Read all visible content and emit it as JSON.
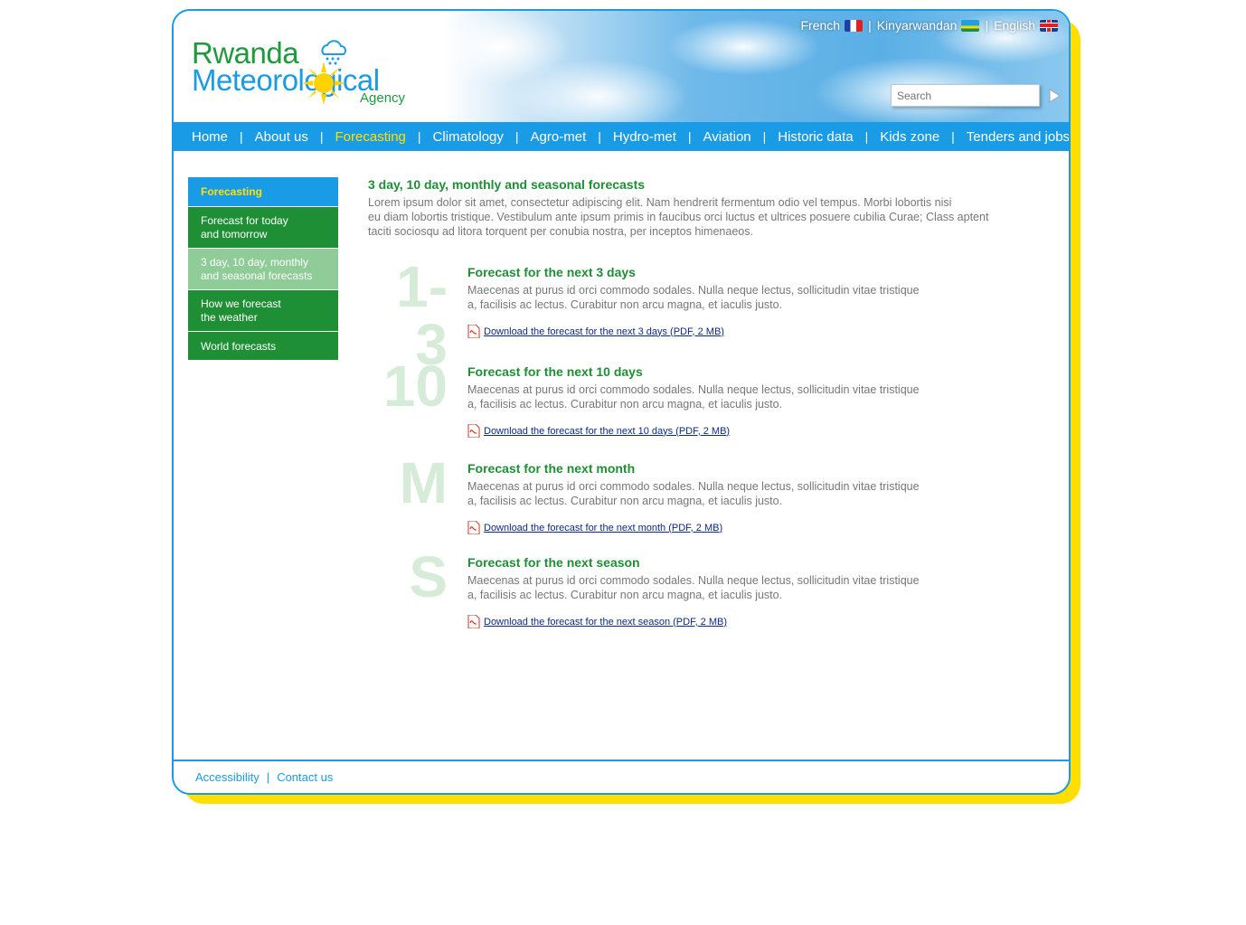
{
  "site": {
    "logo": {
      "line1": "Rwanda",
      "line2": "Meteorological",
      "line3": "Agency"
    }
  },
  "languages": [
    {
      "label": "French",
      "flag": "flag-france-icon"
    },
    {
      "label": "Kinyarwandan",
      "flag": "flag-rwanda-icon"
    },
    {
      "label": "English",
      "flag": "flag-uk-icon"
    }
  ],
  "search": {
    "placeholder": "Search"
  },
  "nav": [
    {
      "label": "Home"
    },
    {
      "label": "About us"
    },
    {
      "label": "Forecasting",
      "active": true
    },
    {
      "label": "Climatology"
    },
    {
      "label": "Agro-met"
    },
    {
      "label": "Hydro-met"
    },
    {
      "label": "Aviation"
    },
    {
      "label": "Historic data"
    },
    {
      "label": "Kids zone"
    },
    {
      "label": "Tenders and jobs"
    }
  ],
  "sidebar": {
    "heading": "Forecasting",
    "items": [
      {
        "line1": "Forecast for today",
        "line2": "and tomorrow"
      },
      {
        "line1": "3 day, 10 day, monthly",
        "line2": "and seasonal forecasts",
        "selected": true
      },
      {
        "line1": "How we forecast",
        "line2": "the weather"
      },
      {
        "line1": "World forecasts",
        "line2": ""
      }
    ]
  },
  "main": {
    "title": "3 day, 10 day, monthly and seasonal forecasts",
    "intro_lines": [
      "Lorem ipsum dolor sit amet, consectetur adipiscing elit. Nam hendrerit fermentum odio vel tempus. Morbi lobortis nisi",
      "eu diam lobortis tristique. Vestibulum ante ipsum primis in faucibus orci luctus et ultrices posuere cubilia Curae; Class aptent",
      "taciti sociosqu ad litora torquent per conubia nostra, per inceptos himenaeos."
    ],
    "sections": [
      {
        "big": "1-3",
        "title": "Forecast for the next 3 days",
        "text_line1": "Maecenas at purus id orci commodo sodales. Nulla neque lectus, sollicitudin vitae tristique",
        "text_line2": "a, facilisis ac lectus. Curabitur non arcu magna, et iaculis justo.",
        "link": "Download the forecast for the next 3 days (PDF, 2 MB)"
      },
      {
        "big": "10",
        "title": "Forecast for the next 10 days",
        "text_line1": "Maecenas at purus id orci commodo sodales. Nulla neque lectus, sollicitudin vitae tristique",
        "text_line2": "a, facilisis ac lectus. Curabitur non arcu magna, et iaculis justo.",
        "link": "Download the forecast for the next 10 days (PDF, 2 MB)"
      },
      {
        "big": "M",
        "title": "Forecast for the next month",
        "text_line1": "Maecenas at purus id orci commodo sodales. Nulla neque lectus, sollicitudin vitae tristique",
        "text_line2": "a, facilisis ac lectus. Curabitur non arcu magna, et iaculis justo.",
        "link": "Download the forecast for the next month (PDF, 2 MB)"
      },
      {
        "big": "S",
        "title": "Forecast for the next season",
        "text_line1": "Maecenas at purus id orci commodo sodales. Nulla neque lectus, sollicitudin vitae tristique",
        "text_line2": "a, facilisis ac lectus. Curabitur non arcu magna, et iaculis justo.",
        "link": "Download the forecast for the next season (PDF, 2 MB)"
      }
    ]
  },
  "footer": {
    "accessibility": "Accessibility",
    "contact": "Contact us"
  },
  "colors": {
    "brand_blue": "#1a9be6",
    "brand_green": "#1e8f35",
    "accent_yellow": "#ffde00"
  }
}
